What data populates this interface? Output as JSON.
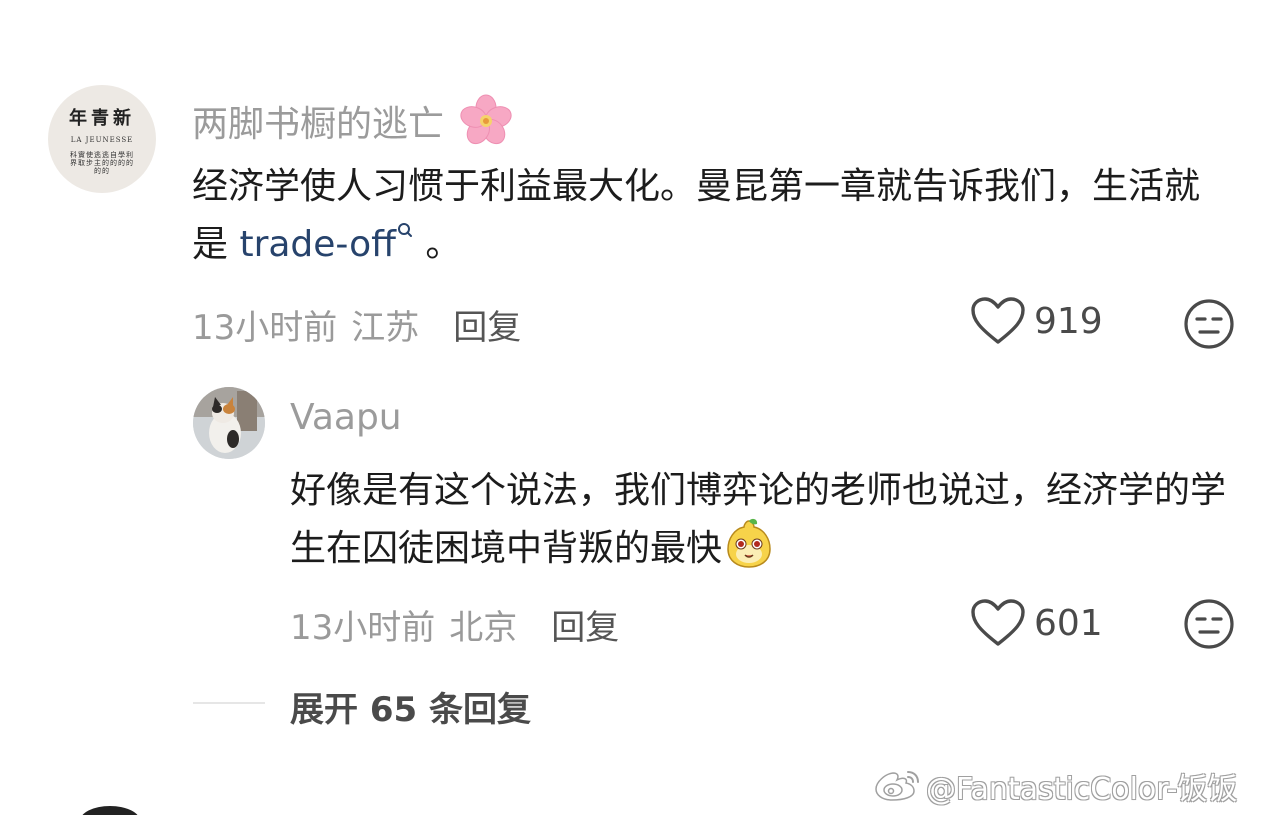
{
  "comment": {
    "avatar_logo": {
      "title": "年青新",
      "subtitle": "LA JEUNESSE",
      "grid_text": "科實使逃逃自學利界取步主的的的的的的"
    },
    "username": "两脚书橱的逃亡",
    "flower_icon": "cherry-blossom-icon",
    "text_part1": "经济学使人习惯于利益最大化。曼昆第一章就告诉我们，生活就是 ",
    "link_text": "trade-off",
    "text_end": " 。",
    "time": "13小时前",
    "location": "江苏",
    "reply_label": "回复",
    "likes": "919"
  },
  "reply": {
    "username": "Vaapu",
    "text": "好像是有这个说法，我们博弈论的老师也说过，经济学的学生在囚徒困境中背叛的最快",
    "emoji": "pear-mascot-emoji",
    "time": "13小时前",
    "location": "北京",
    "reply_label": "回复",
    "likes": "601"
  },
  "expand": {
    "label": "展开 65 条回复"
  },
  "watermark": {
    "text": "@FantasticColor-饭饭",
    "icon": "weibo-icon"
  },
  "colors": {
    "username": "#9b9b9b",
    "link": "#27436c",
    "meta": "#9a9a9a"
  }
}
